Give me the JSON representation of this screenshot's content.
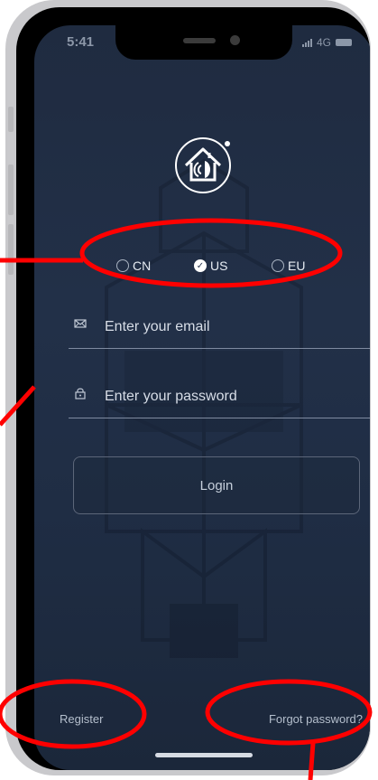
{
  "status_bar": {
    "time": "5:41",
    "network": "4G"
  },
  "regions": [
    {
      "label": "CN",
      "selected": false
    },
    {
      "label": "US",
      "selected": true
    },
    {
      "label": "EU",
      "selected": false
    }
  ],
  "email": {
    "placeholder": "Enter your email",
    "icon": "mail-icon"
  },
  "password": {
    "placeholder": "Enter your password",
    "icon": "lock-icon"
  },
  "login_label": "Login",
  "register_label": "Register",
  "forgot_label": "Forgot password?",
  "colors": {
    "background_top": "#1f2b40",
    "background_bottom": "#1b273a",
    "annotation_red": "#ff0000",
    "frame": "#c9c9cc"
  }
}
